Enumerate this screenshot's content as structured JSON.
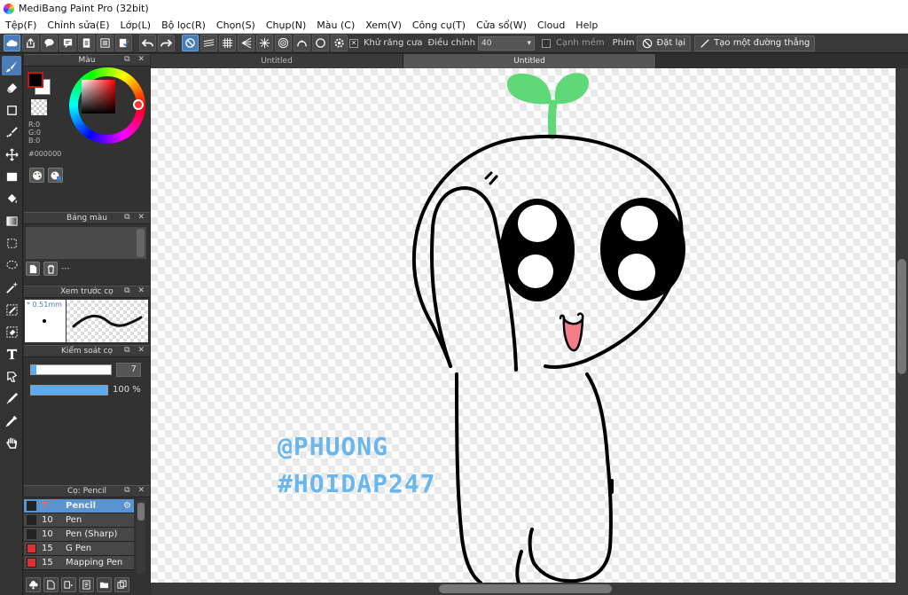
{
  "window": {
    "title": "MediBang Paint Pro (32bit)"
  },
  "menu": [
    "Tệp(F)",
    "Chỉnh sửa(E)",
    "Lớp(L)",
    "Bộ lọc(R)",
    "Chọn(S)",
    "Chụp(N)",
    "Màu (C)",
    "Xem(V)",
    "Công cụ(T)",
    "Cửa sổ(W)",
    "Cloud",
    "Help"
  ],
  "toolbar": {
    "antialias_label": "Khử răng cưa",
    "adjust_label": "Điều chỉnh",
    "adjust_value": "40",
    "edge_label": "Cạnh mềm",
    "key_label": "Phím",
    "reset_label": "Đặt lại",
    "line_label": "Tạo một đường thẳng"
  },
  "panels": {
    "color": {
      "title": "Màu",
      "r": "R:0",
      "g": "G:0",
      "b": "B:0",
      "hex": "#000000",
      "fg_color": "#000000",
      "bg_color": "#ffffff"
    },
    "palette": {
      "title": "Bảng màu",
      "placeholder": "---"
    },
    "preview": {
      "title": "Xem trước cọ",
      "size": "* 0.51mm"
    },
    "control": {
      "title": "Kiểm soát cọ",
      "size_value": "7",
      "size_fraction": 0.07,
      "opacity_value": "100 %",
      "opacity_fraction": 1.0
    },
    "brush": {
      "title": "Cọ: Pencil",
      "items": [
        {
          "size": "7",
          "name": "Pencil",
          "color": "#222222",
          "selected": true
        },
        {
          "size": "10",
          "name": "Pen",
          "color": "#222222",
          "selected": false
        },
        {
          "size": "10",
          "name": "Pen (Sharp)",
          "color": "#222222",
          "selected": false
        },
        {
          "size": "15",
          "name": "G Pen",
          "color": "#e03030",
          "selected": false
        },
        {
          "size": "15",
          "name": "Mapping Pen",
          "color": "#e03030",
          "selected": false
        }
      ]
    }
  },
  "tabs": [
    {
      "label": "Untitled",
      "active": false
    },
    {
      "label": "Untitled",
      "active": true
    }
  ],
  "canvas": {
    "watermark_line1": "@PHUONG",
    "watermark_line2": "#HOIDAP247"
  },
  "colors": {
    "accent": "#4a7db8",
    "sprout": "#5fd878",
    "watermark": "#6ab7f0"
  }
}
